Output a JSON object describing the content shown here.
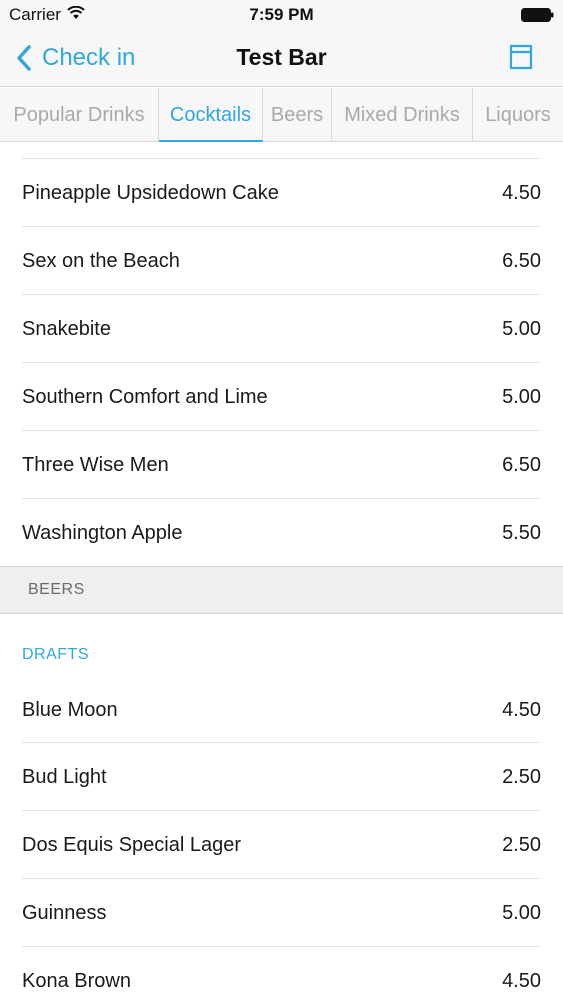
{
  "status_bar": {
    "carrier": "Carrier",
    "time": "7:59 PM"
  },
  "nav": {
    "back_label": "Check in",
    "title": "Test Bar",
    "accent_color": "#2fa7e0"
  },
  "tabs": [
    {
      "label": "Popular Drinks",
      "active": false
    },
    {
      "label": "Cocktails",
      "active": true
    },
    {
      "label": "Beers",
      "active": false
    },
    {
      "label": "Mixed Drinks",
      "active": false
    },
    {
      "label": "Liquors",
      "active": false
    }
  ],
  "cocktails": [
    {
      "name": "Pineapple Upsidedown Cake",
      "price": "4.50"
    },
    {
      "name": "Sex on the Beach",
      "price": "6.50"
    },
    {
      "name": "Snakebite",
      "price": "5.00"
    },
    {
      "name": "Southern Comfort and Lime",
      "price": "5.00"
    },
    {
      "name": "Three Wise Men",
      "price": "6.50"
    },
    {
      "name": "Washington Apple",
      "price": "5.50"
    }
  ],
  "beers_section": {
    "header": "BEERS",
    "subsection": "DRAFTS",
    "items": [
      {
        "name": "Blue Moon",
        "price": "4.50"
      },
      {
        "name": "Bud Light",
        "price": "2.50"
      },
      {
        "name": "Dos Equis Special Lager",
        "price": "2.50"
      },
      {
        "name": "Guinness",
        "price": "5.00"
      },
      {
        "name": "Kona Brown",
        "price": "4.50"
      }
    ]
  }
}
